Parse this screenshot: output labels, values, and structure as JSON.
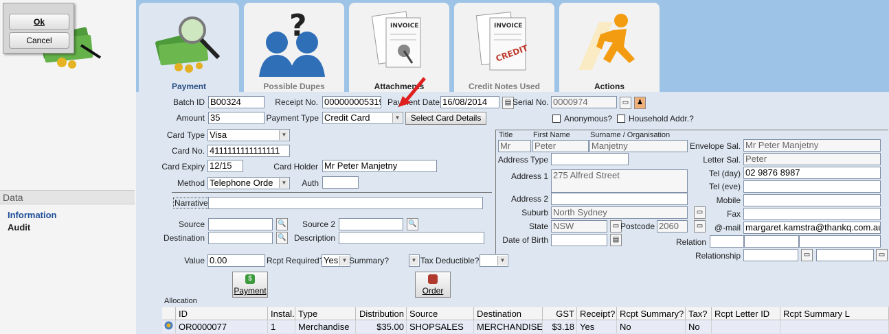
{
  "dialog": {
    "ok_label": "Ok",
    "cancel_label": "Cancel"
  },
  "sidebar": {
    "section_title": "Data",
    "items": [
      {
        "label": "Information"
      },
      {
        "label": "Audit"
      }
    ]
  },
  "tabs": [
    {
      "label": "Payment",
      "active": true
    },
    {
      "label": "Possible Dupes",
      "active": false
    },
    {
      "label": "Attachments",
      "active": false
    },
    {
      "label": "Credit Notes Used",
      "active": false
    },
    {
      "label": "Actions",
      "active": false
    }
  ],
  "payment": {
    "batch_id_label": "Batch ID",
    "batch_id": "B00324",
    "amount_label": "Amount",
    "amount": "35",
    "receipt_no_label": "Receipt No.",
    "receipt_no": "000000005319",
    "payment_type_label": "Payment Type",
    "payment_type": "Credit Card",
    "payment_date_label": "Payment Date",
    "payment_date": "16/08/2014",
    "serial_no_label": "Serial No.",
    "serial_no": "0000974",
    "select_card_label": "Select Card Details",
    "anonymous_label": "Anonymous?",
    "household_label": "Household Addr.?",
    "card_type_label": "Card Type",
    "card_type": "Visa",
    "card_no_label": "Card No.",
    "card_no": "4111111111111111",
    "card_expiry_label": "Card Expiry",
    "card_expiry": "12/15",
    "card_holder_label": "Card Holder",
    "card_holder": "Mr Peter Manjetny",
    "method_label": "Method",
    "method": "Telephone Orde",
    "auth_label": "Auth",
    "auth": "",
    "narrative_label": "Narrative",
    "narrative": "",
    "source_label": "Source",
    "source": "",
    "source2_label": "Source 2",
    "source2": "",
    "destination_label": "Destination",
    "destination": "",
    "description_label": "Description",
    "description": "",
    "value_label": "Value",
    "value": "0.00",
    "rcpt_required_label": "Rcpt Required?",
    "rcpt_required": "Yes",
    "summary_label": "Summary?",
    "summary": "",
    "tax_deductible_label": "Tax Deductible?",
    "tax_deductible": "",
    "payment_btn_label": "Payment",
    "order_btn_label": "Order"
  },
  "contact": {
    "title_label": "Title",
    "title": "Mr",
    "first_name_label": "First Name",
    "first_name": "Peter",
    "surname_label": "Surname / Organisation",
    "surname": "Manjetny",
    "address_type_label": "Address Type",
    "address_type": "",
    "address1_label": "Address 1",
    "address1": "275 Alfred Street",
    "address2_label": "Address 2",
    "address2": "",
    "suburb_label": "Suburb",
    "suburb": "North Sydney",
    "state_label": "State",
    "state": "NSW",
    "postcode_label": "Postcode",
    "postcode": "2060",
    "dob_label": "Date of Birth",
    "dob": "",
    "envelope_sal_label": "Envelope Sal.",
    "envelope_sal": "Mr Peter Manjetny",
    "letter_sal_label": "Letter Sal.",
    "letter_sal": "Peter",
    "tel_day_label": "Tel (day)",
    "tel_day": "02 9876 8987",
    "tel_eve_label": "Tel (eve)",
    "tel_eve": "",
    "mobile_label": "Mobile",
    "mobile": "",
    "fax_label": "Fax",
    "fax": "",
    "email_label": "@-mail",
    "email": "margaret.kamstra@thankq.com.au",
    "relation_label": "Relation",
    "relationship_label": "Relationship"
  },
  "allocation": {
    "label": "Allocation",
    "columns": [
      "ID",
      "Instal.",
      "Type",
      "Distribution",
      "Source",
      "Destination",
      "GST",
      "Receipt?",
      "Rcpt Summary?",
      "Tax?",
      "Rcpt Letter ID",
      "Rcpt Summary L"
    ],
    "rows": [
      [
        "OR0000077",
        "1",
        "Merchandise",
        "$35.00",
        "SHOPSALES",
        "MERCHANDISE",
        "$3.18",
        "Yes",
        "No",
        "No",
        "",
        ""
      ]
    ]
  }
}
